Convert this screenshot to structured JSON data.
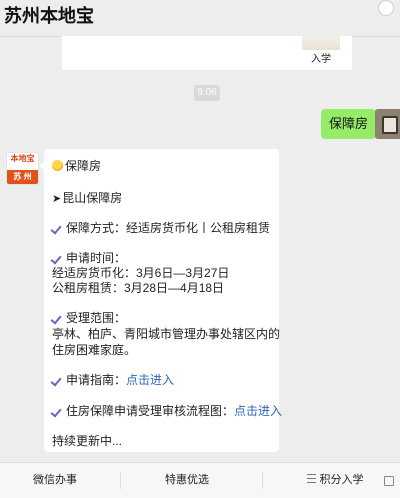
{
  "header": {
    "title": "苏州本地宝"
  },
  "top_card": {
    "label": "入学"
  },
  "timestamp": "9:06",
  "user_message": {
    "text": "保障房"
  },
  "bot_avatar": {
    "brand_top": "本地宝",
    "brand_bottom": "苏 州"
  },
  "reply": {
    "heading": "保障房",
    "subheading": "昆山保障房",
    "guarantee": "保障方式：经适房货币化丨公租房租赁",
    "apply_time_label": "申请时间：",
    "apply_time_1": "经适房货币化：3月6日—3月27日",
    "apply_time_2": "公租房租赁：3月28日—4月18日",
    "scope_label": "受理范围：",
    "scope_1": "亭林、柏庐、青阳城市管理办事处辖区内的",
    "scope_2": "住房困难家庭。",
    "guide_label": "申请指南：",
    "guide_link": "点击进入",
    "process_label": "住房保障申请受理审核流程图：",
    "process_link": "点击进入",
    "footer": "持续更新中..."
  },
  "tabs": [
    "微信办事",
    "特惠优选",
    "积分入学"
  ]
}
